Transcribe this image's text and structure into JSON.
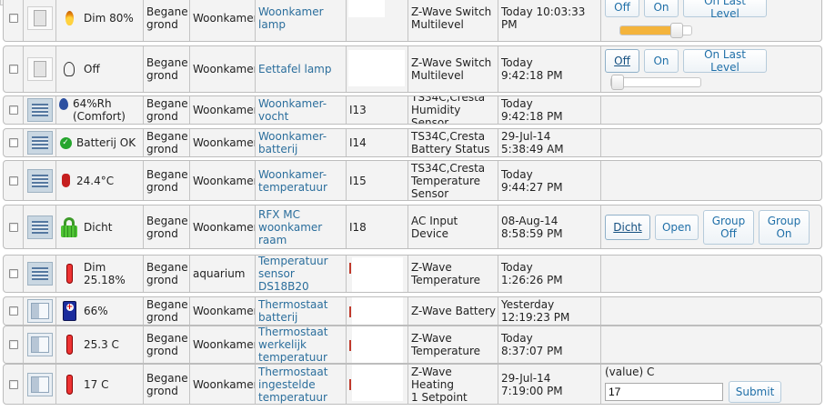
{
  "buttons": {
    "on": "On",
    "off": "Off",
    "on_last_level": "On Last Level",
    "dicht": "Dicht",
    "open": "Open",
    "group_off": "Group\nOff",
    "group_on": "Group\nOn",
    "submit": "Submit"
  },
  "rows": [
    {
      "status": "Dim 80%",
      "floor": "Begane\ngrond",
      "room": "Woonkamer",
      "name": "Woonkamer lamp",
      "id": "",
      "type": "Z-Wave Switch\nMultilevel",
      "time": "Today 10:03:33 PM",
      "slider_level": 0.8
    },
    {
      "status": "Off",
      "floor": "Begane\ngrond",
      "room": "Woonkamer",
      "name": "Eettafel lamp",
      "id": "",
      "type": "Z-Wave Switch\nMultilevel",
      "time": "Today\n9:42:18 PM",
      "slider_level": 0.0
    },
    {
      "status": "64%Rh\n(Comfort)",
      "floor": "Begane\ngrond",
      "room": "Woonkamer",
      "name": "Woonkamer-\nvocht",
      "id": "I13",
      "type": "TS34C,Cresta\nHumidity Sensor",
      "time": "Today\n9:42:18 PM"
    },
    {
      "status": "Batterij OK",
      "floor": "Begane\ngrond",
      "room": "Woonkamer",
      "name": "Woonkamer-\nbatterij",
      "id": "I14",
      "type": "TS34C,Cresta\nBattery Status",
      "time": "29-Jul-14\n5:38:49 AM"
    },
    {
      "status": "24.4°C",
      "floor": "Begane\ngrond",
      "room": "Woonkamer",
      "name": "Woonkamer-\ntemperatuur",
      "id": "I15",
      "type": "TS34C,Cresta\nTemperature\nSensor",
      "time": "Today\n9:44:27 PM"
    },
    {
      "status": "Dicht",
      "floor": "Begane\ngrond",
      "room": "Woonkamer",
      "name": "RFX MC\nwoonkamer raam",
      "id": "I18",
      "type": "AC Input Device",
      "time": "08-Aug-14\n8:58:59 PM"
    },
    {
      "status": "Dim\n25.18%",
      "floor": "Begane\ngrond",
      "room": "aquarium",
      "name": "Temperatuur\nsensor DS18B20",
      "id": "",
      "type": "Z-Wave\nTemperature",
      "time": "Today\n1:26:26 PM"
    },
    {
      "status": "66%",
      "floor": "Begane\ngrond",
      "room": "Woonkamer",
      "name": "Thermostaat\nbatterij",
      "id": "",
      "type": "Z-Wave Battery",
      "time": "Yesterday\n12:19:23 PM"
    },
    {
      "status": "25.3 C",
      "floor": "Begane\ngrond",
      "room": "Woonkamer",
      "name": "Thermostaat\nwerkelijk\ntemperatuur",
      "id": "",
      "type": "Z-Wave\nTemperature",
      "time": "Today\n8:37:07 PM"
    },
    {
      "status": "17 C",
      "floor": "Begane\ngrond",
      "room": "Woonkamer",
      "name": "Thermostaat\ningestelde\ntemperatuur",
      "id": "",
      "type": "Z-Wave Heating\n1 Setpoint",
      "time": "29-Jul-14\n7:19:00 PM",
      "value_label": "(value) C",
      "value": "17"
    }
  ]
}
